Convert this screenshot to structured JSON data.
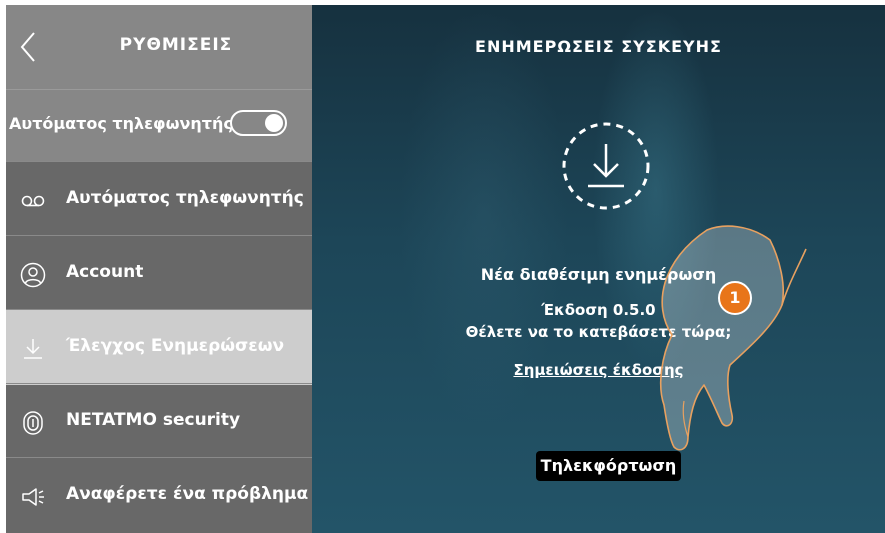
{
  "sidebar": {
    "title": "ΡΥΘΜΙΣΕΙΣ",
    "toggle": {
      "label": "Αυτόματος τηλεφωνητής",
      "state": "on"
    },
    "items": [
      {
        "label": "Αυτόματος τηλεφωνητής",
        "icon": "voicemail-icon",
        "active": false
      },
      {
        "label": "Account",
        "icon": "user-icon",
        "active": false
      },
      {
        "label": "Έλεγχος Ενημερώσεων",
        "icon": "download-icon",
        "active": true
      },
      {
        "label": "NETATMO security",
        "icon": "fingerprint-icon",
        "active": false
      },
      {
        "label": "Αναφέρετε ένα πρόβλημα",
        "icon": "megaphone-icon",
        "active": false
      }
    ]
  },
  "main": {
    "title": "ΕΝΗΜΕΡΩΣΕΙΣ ΣΥΣΚΕΥΗΣ",
    "update_title": "Νέα διαθέσιμη ενημέρωση",
    "version": "Έκδοση 0.5.0",
    "question": "Θέλετε να το κατεβάσετε τώρα;",
    "notes_link": "Σημειώσεις έκδοσης",
    "download_button": "Τηλεκφόρτωση",
    "step_badge": "1"
  },
  "colors": {
    "sidebar_header": "#878787",
    "sidebar_bg": "#686868",
    "active_item": "#cdcdcd",
    "badge": "#e8751a",
    "main_bg": "#1d4658"
  }
}
